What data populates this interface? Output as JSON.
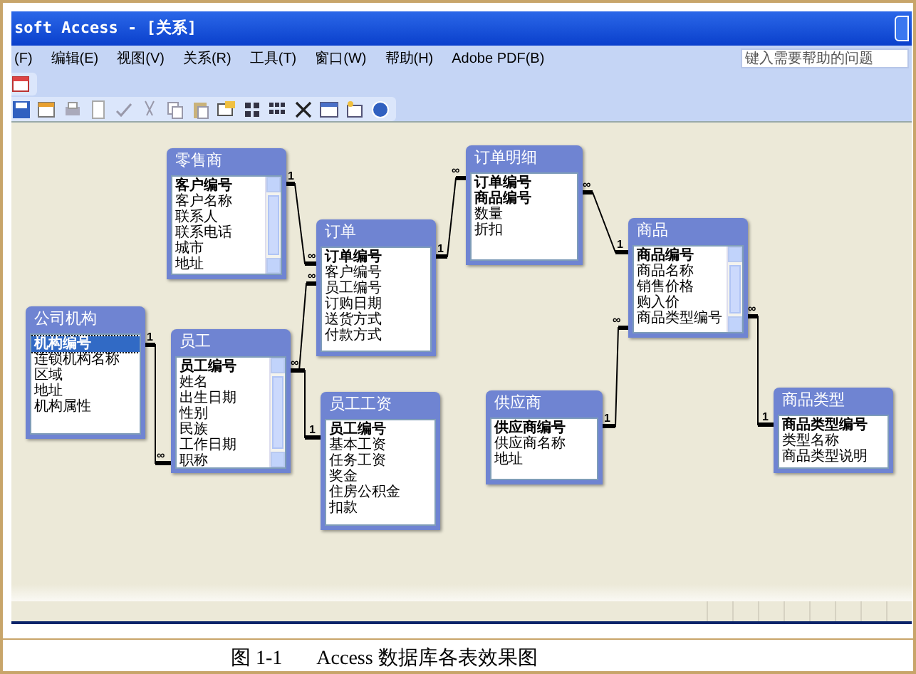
{
  "window": {
    "title": "soft Access - [关系]"
  },
  "menu_bar": {
    "items": [
      "(F)",
      "编辑(E)",
      "视图(V)",
      "关系(R)",
      "工具(T)",
      "窗口(W)",
      "帮助(H)",
      "Adobe PDF(B)"
    ]
  },
  "help_box": {
    "placeholder": "键入需要帮助的问题"
  },
  "tables": [
    {
      "title": "零售商",
      "scrollbar": true,
      "fields": [
        {
          "name": "客户编号",
          "key": true,
          "selected": false
        },
        {
          "name": "客户名称",
          "key": false,
          "selected": false
        },
        {
          "name": "联系人",
          "key": false,
          "selected": false
        },
        {
          "name": "联系电话",
          "key": false,
          "selected": false
        },
        {
          "name": "城市",
          "key": false,
          "selected": false
        },
        {
          "name": "地址",
          "key": false,
          "selected": false
        }
      ]
    },
    {
      "title": "订单",
      "scrollbar": false,
      "fields": [
        {
          "name": "订单编号",
          "key": true,
          "selected": false
        },
        {
          "name": "客户编号",
          "key": false,
          "selected": false
        },
        {
          "name": "员工编号",
          "key": false,
          "selected": false
        },
        {
          "name": "订购日期",
          "key": false,
          "selected": false
        },
        {
          "name": "送货方式",
          "key": false,
          "selected": false
        },
        {
          "name": "付款方式",
          "key": false,
          "selected": false
        }
      ]
    },
    {
      "title": "订单明细",
      "scrollbar": false,
      "fields": [
        {
          "name": "订单编号",
          "key": true,
          "selected": false
        },
        {
          "name": "商品编号",
          "key": true,
          "selected": false
        },
        {
          "name": "数量",
          "key": false,
          "selected": false
        },
        {
          "name": "折扣",
          "key": false,
          "selected": false
        }
      ]
    },
    {
      "title": "商品",
      "scrollbar": true,
      "fields": [
        {
          "name": "商品编号",
          "key": true,
          "selected": false
        },
        {
          "name": "商品名称",
          "key": false,
          "selected": false
        },
        {
          "name": "销售价格",
          "key": false,
          "selected": false
        },
        {
          "name": "购入价",
          "key": false,
          "selected": false
        },
        {
          "name": "商品类型编号",
          "key": false,
          "selected": false
        }
      ]
    },
    {
      "title": "公司机构",
      "scrollbar": false,
      "fields": [
        {
          "name": "机构编号",
          "key": true,
          "selected": true
        },
        {
          "name": "连锁机构名称",
          "key": false,
          "selected": false
        },
        {
          "name": "区域",
          "key": false,
          "selected": false
        },
        {
          "name": "地址",
          "key": false,
          "selected": false
        },
        {
          "name": "机构属性",
          "key": false,
          "selected": false
        }
      ]
    },
    {
      "title": "员工",
      "scrollbar": true,
      "fields": [
        {
          "name": "员工编号",
          "key": true,
          "selected": false
        },
        {
          "name": "姓名",
          "key": false,
          "selected": false
        },
        {
          "name": "出生日期",
          "key": false,
          "selected": false
        },
        {
          "name": "性别",
          "key": false,
          "selected": false
        },
        {
          "name": "民族",
          "key": false,
          "selected": false
        },
        {
          "name": "工作日期",
          "key": false,
          "selected": false
        },
        {
          "name": "职称",
          "key": false,
          "selected": false
        }
      ]
    },
    {
      "title": "员工工资",
      "scrollbar": false,
      "fields": [
        {
          "name": "员工编号",
          "key": true,
          "selected": false
        },
        {
          "name": "基本工资",
          "key": false,
          "selected": false
        },
        {
          "name": "任务工资",
          "key": false,
          "selected": false
        },
        {
          "name": "奖金",
          "key": false,
          "selected": false
        },
        {
          "name": "住房公积金",
          "key": false,
          "selected": false
        },
        {
          "name": "扣款",
          "key": false,
          "selected": false
        }
      ]
    },
    {
      "title": "供应商",
      "scrollbar": false,
      "fields": [
        {
          "name": "供应商编号",
          "key": true,
          "selected": false
        },
        {
          "name": "供应商名称",
          "key": false,
          "selected": false
        },
        {
          "name": "地址",
          "key": false,
          "selected": false
        }
      ]
    },
    {
      "title": "商品类型",
      "scrollbar": false,
      "fields": [
        {
          "name": "商品类型编号",
          "key": true,
          "selected": false
        },
        {
          "name": "类型名称",
          "key": false,
          "selected": false
        },
        {
          "name": "商品类型说明",
          "key": false,
          "selected": false
        }
      ]
    }
  ],
  "relationships": [
    {
      "from_label": "1",
      "to_label": "∞"
    },
    {
      "from_label": "∞",
      "to_label": "∞"
    },
    {
      "to_label": "1"
    },
    {
      "from_label": "1",
      "to_label": "∞"
    },
    {
      "from_label": "1",
      "to_label": "∞"
    },
    {
      "from_label": "∞",
      "to_label": "1"
    },
    {
      "from_label": "1",
      "to_label": "∞"
    },
    {
      "from_label": "∞",
      "to_label": "1"
    }
  ],
  "caption": {
    "figure": "图 1-1",
    "text": "Access 数据库各表效果图"
  }
}
